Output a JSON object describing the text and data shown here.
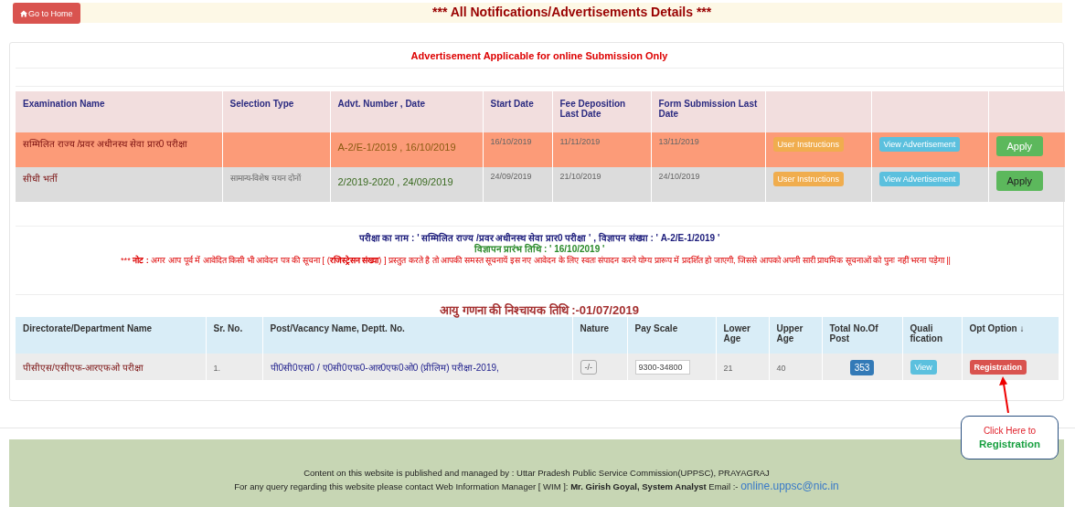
{
  "top_bar": {
    "home_button": "Go to Home",
    "title": "*** All Notifications/Advertisements Details ***"
  },
  "advertisements": {
    "heading": "Advertisement Applicable for online Submission Only",
    "columns": [
      "Examination Name",
      "Selection Type",
      "Advt. Number , Date",
      "Start Date",
      "Fee Deposition Last Date",
      "Form Submission Last Date"
    ],
    "rows": [
      {
        "highlighted": true,
        "exam": "सम्मिलित राज्य /प्रवर अधीनस्थ सेवा प्रार0 परीक्षा",
        "advt": "A-2/E-1/2019 , 16/10/2019",
        "start": "16/10/2019",
        "fee": "11/11/2019",
        "form": "13/11/2019",
        "instructions": "User Instructions",
        "view": "View Advertisement",
        "apply": "Apply"
      },
      {
        "highlighted": false,
        "exam": "सीधी भर्ती",
        "selection_type": "सामान्य-विशेष चयन दोनों",
        "advt": "2/2019-2020 , 24/09/2019",
        "start": "24/09/2019",
        "fee": "21/10/2019",
        "form": "24/10/2019",
        "instructions": "User Instructions",
        "view": "View Advertisement",
        "apply": "Apply"
      }
    ]
  },
  "info": {
    "exam_line": "परीक्षा का नाम : ' सम्मिलित राज्य /प्रवर अधीनस्थ सेवा प्रार0 परीक्षा ' , विज्ञापन संख्या : ' A-2/E-1/2019 '",
    "start_line": "विज्ञापन प्रारंभ तिथि : ' 16/10/2019 '",
    "note_prefix": "***",
    "note": "**नोट :** अगर आप पूर्व में आवेदित किसी भी आवेदन पत्र की सूचना [ (**रजिस्ट्रेसन संख्या**) ] प्रस्तुत करते है तो आपकी समस्त सूचनायें इस नए आवेदन के लिए स्वतः संपादन करने योग्य प्रारूप में प्रदर्शित हो जाएगी, जिससे आपको अपनी सारी प्राथमिक सूचनाओं को पुनः नहीं भरना पड़ेगा ||"
  },
  "posts": {
    "title": "आयु गणना की निश्चायक तिथि :-01/07/2019",
    "columns": [
      "Directorate/Department Name",
      "Sr. No.",
      "Post/Vacancy Name, Deptt. No.",
      "Nature",
      "Pay Scale",
      "Lower Age",
      "Upper Age",
      "Total No.Of Post",
      "Quali fication",
      "Opt Option ↓"
    ],
    "rows": [
      {
        "department": "पीसीएस/एसीएफ-आरएफओ परीक्षा",
        "sr_no": "1.",
        "post": "पी0सी0एस0 / ए0सी0एफ0-आर0एफ0ओ0 (प्रीलिम) परीक्षा-2019,",
        "nature": "-/-",
        "pay_scale": "9300-34800",
        "lower_age": "21",
        "upper_age": "40",
        "total_posts": "353",
        "qualification": "View",
        "option": "Registration"
      }
    ]
  },
  "callout": {
    "line_1": "Click Here to",
    "line_2": "Registration"
  },
  "footer": {
    "line_1": "Content on this website is published and managed by : Uttar Pradesh Public Service Commission(UPPSC), PRAYAGRAJ",
    "line_2": "For any query regarding this website please contact Web Information Manager [ WIM ]: **Mr. Girish Goyal, System Analyst** Email :- ",
    "email": "online.uppsc@nic.in"
  }
}
